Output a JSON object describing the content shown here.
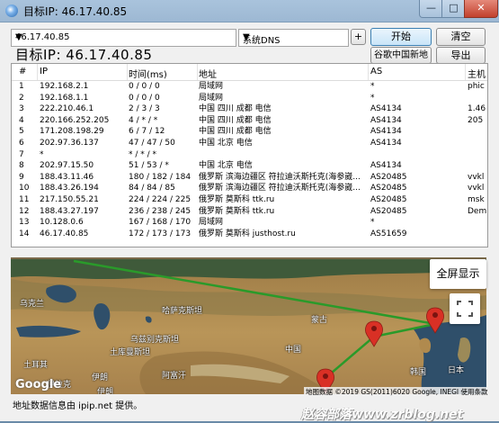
{
  "window": {
    "title": "目标IP: 46.17.40.85",
    "minimize_label": "—",
    "maximize_label": "□",
    "close_label": "✕"
  },
  "toolbar": {
    "ip_value": "46.17.40.85",
    "dns_value": "系统DNS",
    "add_label": "+",
    "start_label": "开始",
    "clear_label": "清空",
    "google_map_label": "谷歌中国新地图",
    "export_label": "导出"
  },
  "target_label": "目标IP:  46.17.40.85",
  "table": {
    "headers": [
      "#",
      "IP",
      "时间(ms)",
      "地址",
      "AS",
      "主机"
    ],
    "rows": [
      [
        "1",
        "192.168.2.1",
        "0 / 0 / 0",
        "局域网",
        "*",
        "phic"
      ],
      [
        "2",
        "192.168.1.1",
        "0 / 0 / 0",
        "局域网",
        "*",
        ""
      ],
      [
        "3",
        "222.210.46.1",
        "2 / 3 / 3",
        "中国 四川 成都 电信",
        "AS4134",
        "1.46"
      ],
      [
        "4",
        "220.166.252.205",
        "4 / * / *",
        "中国 四川 成都 电信",
        "AS4134",
        "205"
      ],
      [
        "5",
        "171.208.198.29",
        "6 / 7 / 12",
        "中国 四川 成都 电信",
        "AS4134",
        ""
      ],
      [
        "6",
        "202.97.36.137",
        "47 / 47 / 50",
        "中国 北京 电信",
        "AS4134",
        ""
      ],
      [
        "7",
        "*",
        "* / * / *",
        "",
        "",
        ""
      ],
      [
        "8",
        "202.97.15.50",
        "51 / 53 / *",
        "中国 北京 电信",
        "AS4134",
        ""
      ],
      [
        "9",
        "188.43.11.46",
        "180 / 182 / 184",
        "俄罗斯 滨海边疆区 符拉迪沃斯托克(海参崴...",
        "AS20485",
        "vvkl"
      ],
      [
        "10",
        "188.43.26.194",
        "84 / 84 / 85",
        "俄罗斯 滨海边疆区 符拉迪沃斯托克(海参崴...",
        "AS20485",
        "vvkl"
      ],
      [
        "11",
        "217.150.55.21",
        "224 / 224 / 225",
        "俄罗斯 莫斯科 ttk.ru",
        "AS20485",
        "msk"
      ],
      [
        "12",
        "188.43.27.197",
        "236 / 238 / 245",
        "俄罗斯 莫斯科 ttk.ru",
        "AS20485",
        "Dem"
      ],
      [
        "13",
        "10.128.0.6",
        "167 / 168 / 170",
        "局域网",
        "*",
        ""
      ],
      [
        "14",
        "46.17.40.85",
        "172 / 173 / 173",
        "俄罗斯 莫斯科 justhost.ru",
        "AS51659",
        ""
      ]
    ]
  },
  "map": {
    "fullscreen_label": "全屏显示",
    "labels": [
      "乌克兰",
      "哈萨克斯坦",
      "蒙古",
      "乌兹别克斯坦",
      "土库曼斯坦",
      "土耳其",
      "伊拉克",
      "伊朗",
      "阿富汗",
      "中国",
      "日本",
      "韩国",
      "伊朗"
    ],
    "google_label": "Google",
    "copyright": "地图数据 ©2019 GS(2011)6020 Google, INEGI   使用条款"
  },
  "source_text": "地址数据信息由 ipip.net 提供。",
  "watermark": "赵容部落www.zrblog.net",
  "colors": {
    "route": "#2a9a2a",
    "marker": "#d93025",
    "start_border": "#3c7fb1"
  }
}
